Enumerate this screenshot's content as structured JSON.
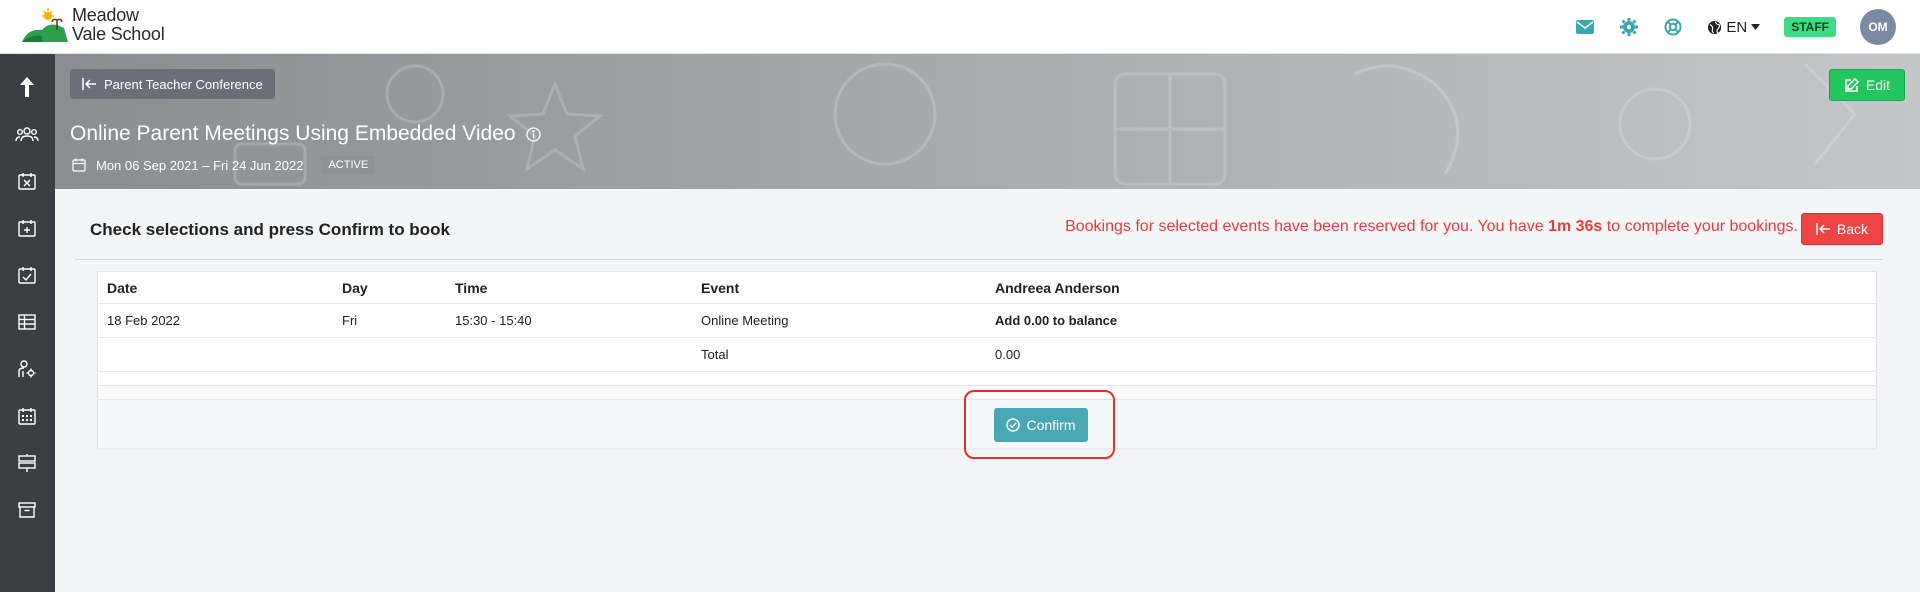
{
  "brand": {
    "name_line1": "Meadow",
    "name_line2": "Vale School"
  },
  "topbar": {
    "language": "EN",
    "role_badge": "STAFF",
    "avatar_initials": "OM"
  },
  "banner": {
    "back_label": "Parent Teacher Conference",
    "edit_label": "Edit",
    "title": "Online Parent Meetings Using Embedded Video",
    "date_range": "Mon 06 Sep 2021 – Fri 24 Jun 2022",
    "status": "ACTIVE"
  },
  "content": {
    "heading": "Check selections and press Confirm to book",
    "notice_pre": "Bookings for selected events have been reserved for you. You have ",
    "notice_time": "1m 36s",
    "notice_post": " to complete your bookings.",
    "back_label": "Back"
  },
  "table": {
    "headers": [
      "Date",
      "Day",
      "Time",
      "Event",
      "Andreea Anderson"
    ],
    "rows": [
      [
        "18 Feb 2022",
        "Fri",
        "15:30 - 15:40",
        "Online Meeting",
        "Add 0.00 to balance"
      ]
    ],
    "total_label": "Total",
    "total_value": "0.00"
  },
  "confirm_label": "Confirm",
  "colors": {
    "accent_teal": "#4aa8b4",
    "danger": "#ef4444",
    "success": "#22c55e",
    "sidebar": "#3b3f45"
  },
  "icons": {
    "mail": "envelope-icon",
    "settings": "gear-icon",
    "help": "lifebuoy-icon",
    "language": "globe-icon"
  }
}
